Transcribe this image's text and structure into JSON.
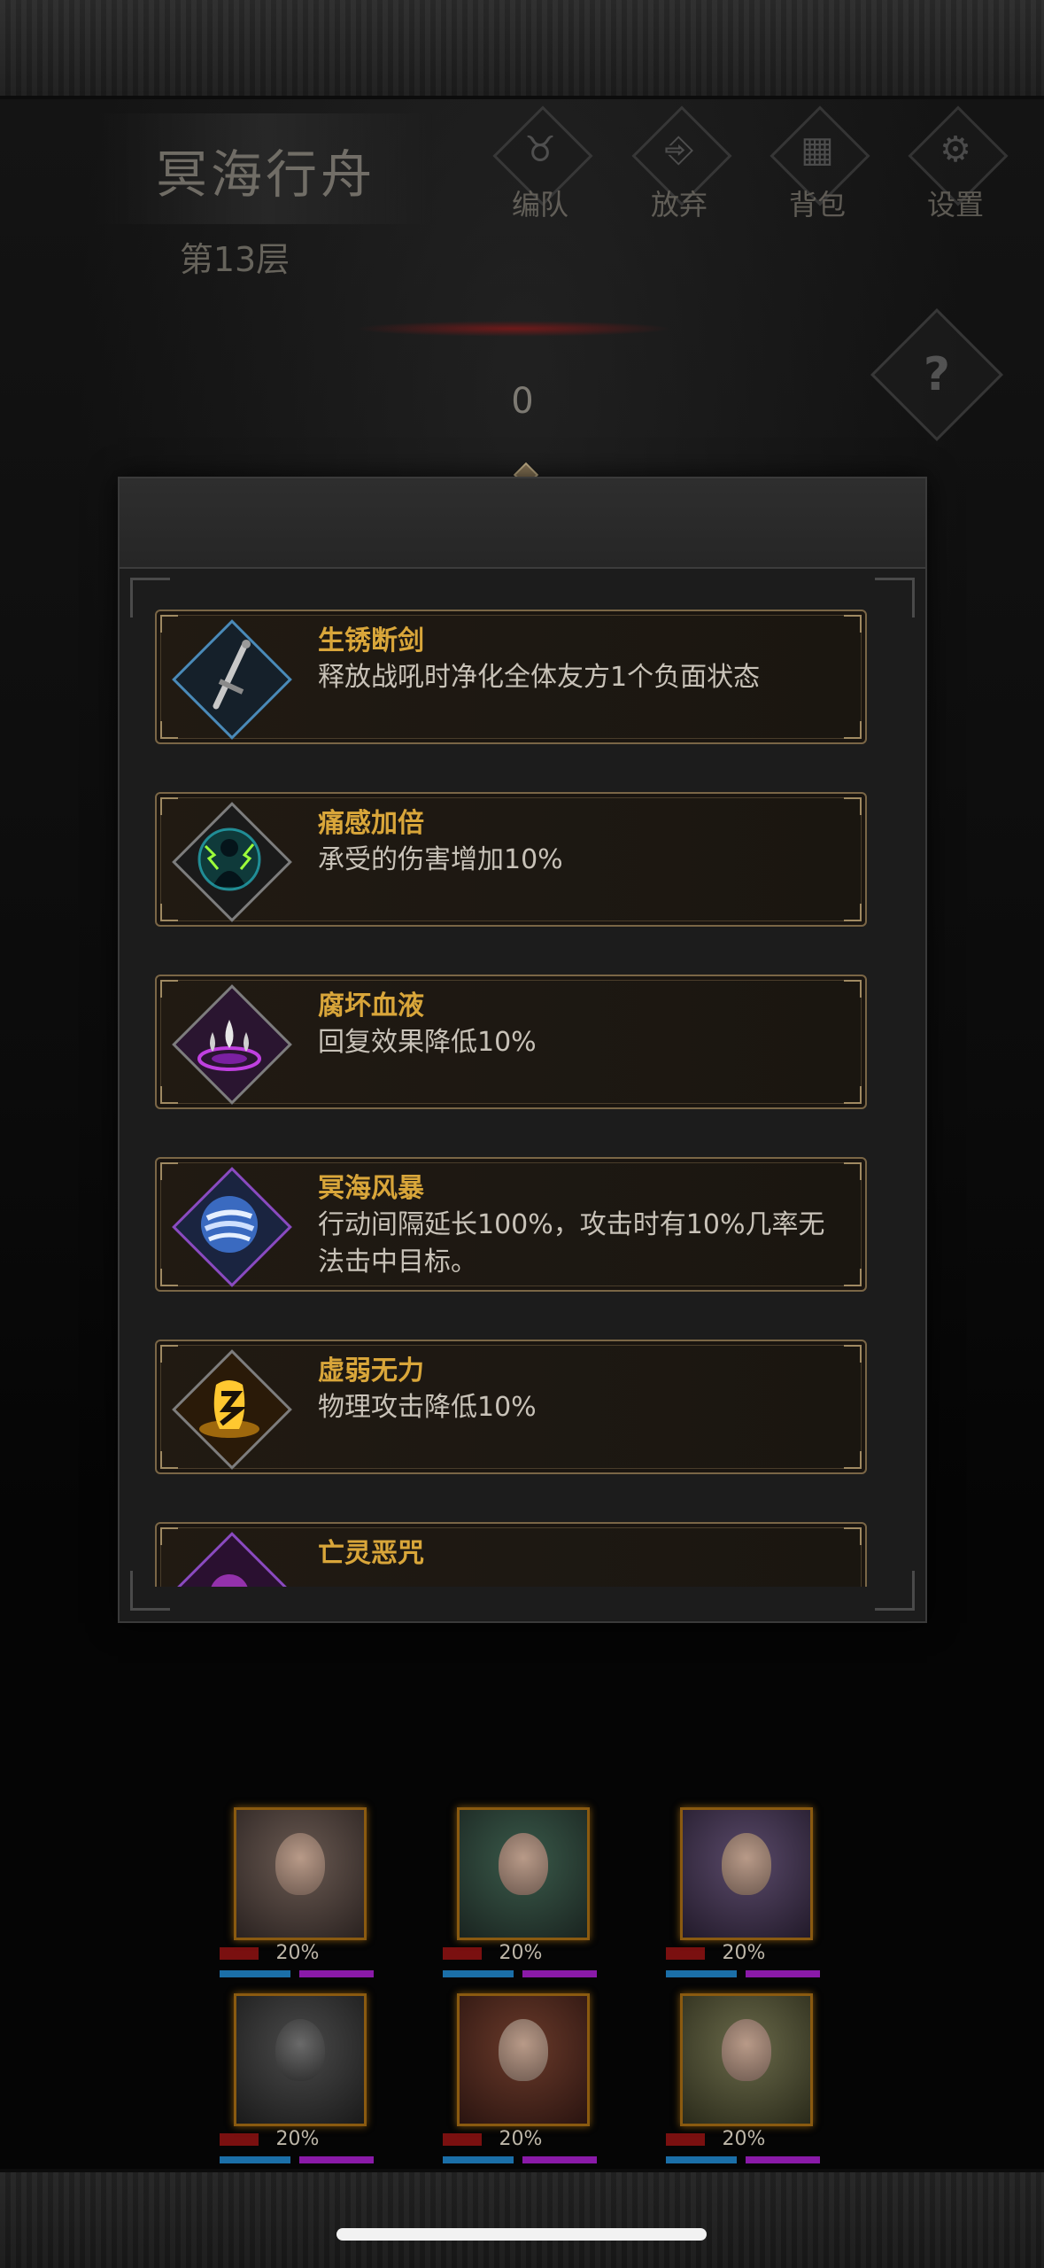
{
  "hud": {
    "level_name": "冥海行舟",
    "floor": "第13层",
    "nav": [
      {
        "label": "编队",
        "icon": "horned-helmet-icon"
      },
      {
        "label": "放弃",
        "icon": "exit-door-icon"
      },
      {
        "label": "背包",
        "icon": "backpack-icon"
      },
      {
        "label": "设置",
        "icon": "gear-icon"
      }
    ],
    "score": "0",
    "help_glyph": "?"
  },
  "effects": [
    {
      "name": "生锈断剑",
      "desc": "释放战吼时净化全体友方1个负面状态",
      "icon": "broken-sword-icon",
      "frame_color": "#4a8ab8"
    },
    {
      "name": "痛感加倍",
      "desc": "承受的伤害增加10%",
      "icon": "shocked-figure-icon",
      "frame_color": "#7d7d7d"
    },
    {
      "name": "腐坏血液",
      "desc": "回复效果降低10%",
      "icon": "blood-drops-icon",
      "frame_color": "#7d7d7d"
    },
    {
      "name": "冥海风暴",
      "desc": "行动间隔延长100%，攻击时有10%几率无法击中目标。",
      "icon": "storm-orb-icon",
      "frame_color": "#8a4ac0"
    },
    {
      "name": "虚弱无力",
      "desc": "物理攻击降低10%",
      "icon": "weakness-rune-icon",
      "frame_color": "#7d7d7d"
    },
    {
      "name": "亡灵恶咒",
      "desc": "",
      "icon": "undead-curse-icon",
      "frame_color": "#8a4ac0"
    }
  ],
  "team": [
    {
      "percent": "20%"
    },
    {
      "percent": "20%"
    },
    {
      "percent": "20%"
    },
    {
      "percent": "20%"
    },
    {
      "percent": "20%"
    },
    {
      "percent": "20%"
    }
  ],
  "colors": {
    "effect_name": "#d9a63a",
    "card_border": "#7a6646",
    "hp": "#7a1010",
    "mana": "#1b6fa8",
    "rage": "#8a1aa8"
  }
}
